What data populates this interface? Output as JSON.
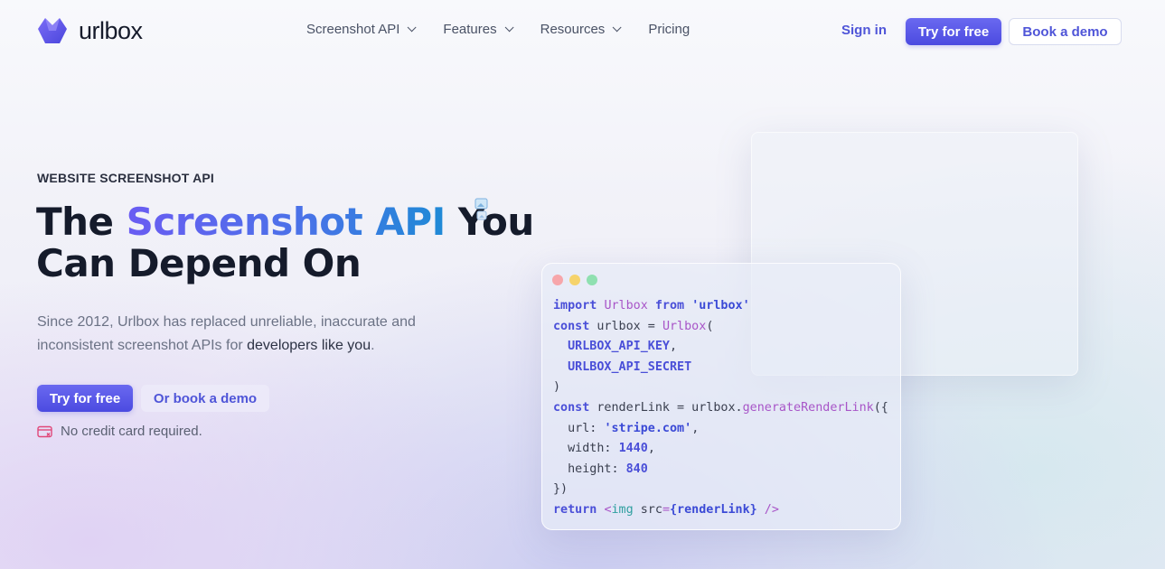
{
  "brand": {
    "name": "urlbox"
  },
  "nav": {
    "items": [
      {
        "label": "Screenshot API",
        "dropdown": true
      },
      {
        "label": "Features",
        "dropdown": true
      },
      {
        "label": "Resources",
        "dropdown": true
      },
      {
        "label": "Pricing",
        "dropdown": false
      }
    ],
    "sign_in": "Sign in",
    "try_free": "Try for free",
    "book_demo": "Book a demo"
  },
  "hero": {
    "eyebrow": "WEBSITE SCREENSHOT API",
    "headline_prefix": "The ",
    "headline_highlight": "Screenshot API",
    "headline_after": " You",
    "headline_line2": "Can Depend On",
    "subtitle_main": "Since 2012, Urlbox has replaced unreliable, inaccurate and inconsistent screenshot APIs for ",
    "subtitle_emphasis": "developers like you",
    "subtitle_end": ".",
    "cta_primary": "Try for free",
    "cta_secondary": "Or book a demo",
    "note": "No credit card required."
  },
  "code": {
    "kw_import": "import",
    "module_name": "Urlbox",
    "kw_from": "from",
    "module_path": "'urlbox'",
    "kw_const": "const",
    "var_urlbox": " urlbox = ",
    "ctor": "Urlbox",
    "open_paren": "(",
    "api_key": "URLBOX_API_KEY",
    "api_secret": "URLBOX_API_SECRET",
    "close_paren": ")",
    "var_render": " renderLink = urlbox.",
    "method": "generateRenderLink",
    "open_call": "({",
    "url_key": "url: ",
    "url_val": "'stripe.com'",
    "width_key": "width: ",
    "width_val": "1440",
    "height_key": "height: ",
    "height_val": "840",
    "close_call": "})",
    "kw_return": "return",
    "jsx_open": "<",
    "jsx_tag": "img",
    "jsx_attr": " src",
    "jsx_eq": "=",
    "jsx_expr": "{renderLink}",
    "jsx_close": " />"
  },
  "colors": {
    "accent": "#4b4be0",
    "headline_gradient": [
      "#6a5cf2",
      "#1f8ad6"
    ],
    "window_dots": [
      "#f7a6aa",
      "#f6d36b",
      "#8fe0b0"
    ]
  }
}
